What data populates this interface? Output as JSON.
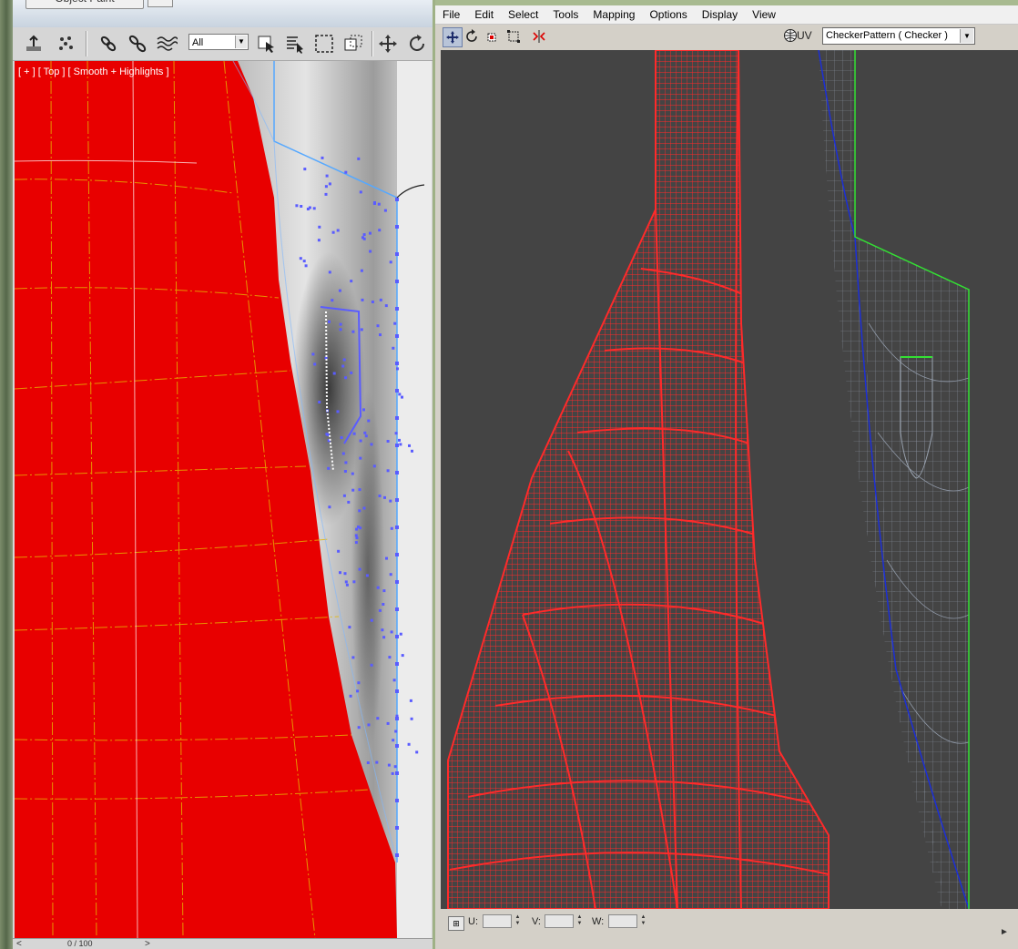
{
  "main": {
    "command_tab_label": "Object Paint",
    "toolbar": {
      "selection_filter": "All",
      "icons": [
        "snap-grid-icon",
        "particles-icon",
        "link-icon",
        "unlink-icon",
        "bind-spacewarp-icon",
        "select-object-icon",
        "select-by-name-icon",
        "rect-selection-region-icon",
        "window-crossing-icon",
        "move-icon",
        "rotate-icon"
      ]
    },
    "viewport": {
      "label": "[ + ] [ Top ] [ Smooth + Highlights ]"
    },
    "timeline": {
      "prev": "<",
      "frame": "0 / 100",
      "next": ">"
    }
  },
  "uv_editor": {
    "menu": [
      "File",
      "Edit",
      "Select",
      "Tools",
      "Mapping",
      "Options",
      "Display",
      "View"
    ],
    "toolbar_icons": [
      "move-icon",
      "rotate-icon",
      "scale-icon",
      "freeform-icon",
      "mirror-icon"
    ],
    "texture_prefix": "UV",
    "texture_selected": "CheckerPattern  ( Checker )",
    "coords": [
      {
        "label": "U:",
        "value": ""
      },
      {
        "label": "V:",
        "value": ""
      },
      {
        "label": "W:",
        "value": ""
      }
    ]
  },
  "colors": {
    "mesh_red": "#e80000",
    "uv_red": "#ff2a2a",
    "seam_blue": "#1c2fd6",
    "seam_green": "#33e033",
    "uv_bg": "#444444",
    "vertex_blue": "#5a5cff"
  }
}
